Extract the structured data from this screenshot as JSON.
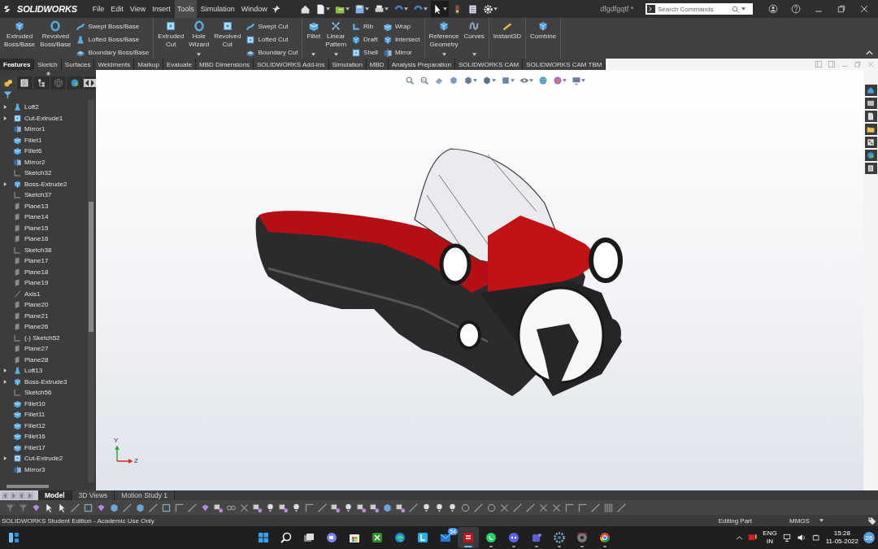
{
  "app": {
    "logo": "SOLIDWORKS",
    "document_title": "dfgdfgqtf *"
  },
  "menu": [
    {
      "label": "File",
      "selected": false
    },
    {
      "label": "Edit",
      "selected": false
    },
    {
      "label": "View",
      "selected": false
    },
    {
      "label": "Insert",
      "selected": false
    },
    {
      "label": "Tools",
      "selected": true
    },
    {
      "label": "Simulation",
      "selected": false
    },
    {
      "label": "Window",
      "selected": false
    }
  ],
  "search": {
    "placeholder": "Search Commands"
  },
  "ribbon": [
    {
      "items": [
        {
          "kind": "large",
          "label": "Extruded Boss/Base",
          "dropdown": false
        },
        {
          "kind": "large",
          "label": "Revolved Boss/Base",
          "dropdown": false
        },
        {
          "kind": "stack",
          "labels": [
            "Swept Boss/Base",
            "Lofted Boss/Base",
            "Boundary Boss/Base"
          ]
        }
      ]
    },
    {
      "items": [
        {
          "kind": "large",
          "label": "Extruded Cut",
          "dropdown": false
        },
        {
          "kind": "large",
          "label": "Hole Wizard",
          "dropdown": true
        },
        {
          "kind": "large",
          "label": "Revolved Cut",
          "dropdown": false
        },
        {
          "kind": "stack",
          "labels": [
            "Swept Cut",
            "Lofted Cut",
            "Boundary Cut"
          ]
        }
      ]
    },
    {
      "items": [
        {
          "kind": "large",
          "label": "Fillet",
          "dropdown": true
        },
        {
          "kind": "large",
          "label": "Linear Pattern",
          "dropdown": true
        },
        {
          "kind": "stack",
          "labels": [
            "Rib",
            "Draft",
            "Shell"
          ]
        },
        {
          "kind": "stack",
          "labels": [
            "Wrap",
            "Intersect",
            "Mirror"
          ]
        }
      ]
    },
    {
      "items": [
        {
          "kind": "large",
          "label": "Reference Geometry",
          "dropdown": true
        },
        {
          "kind": "large",
          "label": "Curves",
          "dropdown": true
        }
      ]
    },
    {
      "items": [
        {
          "kind": "large",
          "label": "Instant3D",
          "dropdown": false
        }
      ]
    },
    {
      "items": [
        {
          "kind": "large",
          "label": "Combine",
          "dropdown": false
        }
      ]
    }
  ],
  "feature_tabs": [
    {
      "label": "Features",
      "selected": true
    },
    {
      "label": "Sketch",
      "selected": false
    },
    {
      "label": "Surfaces",
      "selected": false
    },
    {
      "label": "Weldments",
      "selected": false
    },
    {
      "label": "Markup",
      "selected": false
    },
    {
      "label": "Evaluate",
      "selected": false
    },
    {
      "label": "MBD Dimensions",
      "selected": false
    },
    {
      "label": "SOLIDWORKS Add-Ins",
      "selected": false
    },
    {
      "label": "Simulation",
      "selected": false
    },
    {
      "label": "MBD",
      "selected": false
    },
    {
      "label": "Analysis Preparation",
      "selected": false
    },
    {
      "label": "SOLIDWORKS CAM",
      "selected": false
    },
    {
      "label": "SOLIDWORKS CAM TBM",
      "selected": false
    }
  ],
  "tree": [
    {
      "label": "Loft2",
      "kind": "loft",
      "expanded": false
    },
    {
      "label": "Cut-Extrude1",
      "kind": "cut",
      "expanded": false
    },
    {
      "label": "Mirror1",
      "kind": "mirror"
    },
    {
      "label": "Fillet1",
      "kind": "fillet"
    },
    {
      "label": "Fillet6",
      "kind": "fillet"
    },
    {
      "label": "Mirror2",
      "kind": "mirror"
    },
    {
      "label": "Sketch32",
      "kind": "sketch"
    },
    {
      "label": "Boss-Extrude2",
      "kind": "boss",
      "expanded": false
    },
    {
      "label": "Sketch37",
      "kind": "sketch"
    },
    {
      "label": "Plane13",
      "kind": "plane"
    },
    {
      "label": "Plane14",
      "kind": "plane"
    },
    {
      "label": "Plane15",
      "kind": "plane"
    },
    {
      "label": "Plane16",
      "kind": "plane"
    },
    {
      "label": "Sketch38",
      "kind": "sketch"
    },
    {
      "label": "Plane17",
      "kind": "plane"
    },
    {
      "label": "Plane18",
      "kind": "plane"
    },
    {
      "label": "Plane19",
      "kind": "plane"
    },
    {
      "label": "Axis1",
      "kind": "axis"
    },
    {
      "label": "Plane20",
      "kind": "plane"
    },
    {
      "label": "Plane21",
      "kind": "plane"
    },
    {
      "label": "Plane26",
      "kind": "plane"
    },
    {
      "label": "(-) Sketch52",
      "kind": "sketch"
    },
    {
      "label": "Plane27",
      "kind": "plane"
    },
    {
      "label": "Plane28",
      "kind": "plane"
    },
    {
      "label": "Loft13",
      "kind": "loft",
      "expanded": false
    },
    {
      "label": "Boss-Extrude3",
      "kind": "boss",
      "expanded": false
    },
    {
      "label": "Sketch56",
      "kind": "sketch"
    },
    {
      "label": "Fillet10",
      "kind": "fillet"
    },
    {
      "label": "Fillet11",
      "kind": "fillet"
    },
    {
      "label": "Fillet12",
      "kind": "fillet"
    },
    {
      "label": "Fillet16",
      "kind": "fillet"
    },
    {
      "label": "Fillet17",
      "kind": "fillet"
    },
    {
      "label": "Cut-Extrude2",
      "kind": "cut",
      "expanded": false
    },
    {
      "label": "Mirror3",
      "kind": "mirror"
    }
  ],
  "triad": {
    "up": "Y",
    "right": "Z"
  },
  "panel_tabs": [
    {
      "selected": true
    },
    {
      "selected": false
    },
    {
      "selected": false
    },
    {
      "selected": false
    },
    {
      "selected": false
    }
  ],
  "view_tabs": [
    {
      "label": "Model",
      "selected": true
    },
    {
      "label": "3D Views",
      "selected": false
    },
    {
      "label": "Motion Study 1",
      "selected": false
    }
  ],
  "status_bar": {
    "edition": "SOLIDWORKS Student Edition - Academic Use Only",
    "mode": "Editing Part",
    "units": "MMGS"
  },
  "taskbar": {
    "widgets": {
      "kind": "widgets"
    },
    "apps": [
      {
        "kind": "start",
        "running": false,
        "selected": false
      },
      {
        "kind": "search",
        "running": false,
        "selected": false
      },
      {
        "kind": "taskview",
        "running": false,
        "selected": false
      },
      {
        "kind": "chat",
        "running": false,
        "selected": false
      },
      {
        "kind": "store",
        "running": false,
        "selected": false
      },
      {
        "kind": "xbox",
        "running": false,
        "selected": false
      },
      {
        "kind": "edge",
        "running": false,
        "selected": false
      },
      {
        "kind": "launcher",
        "running": false,
        "selected": false
      },
      {
        "kind": "mail",
        "running": false,
        "selected": false,
        "badge": "54"
      },
      {
        "kind": "solidworks",
        "running": true,
        "selected": true
      },
      {
        "kind": "whatsapp",
        "running": true,
        "selected": false
      },
      {
        "kind": "discord",
        "running": true,
        "selected": false
      },
      {
        "kind": "teams",
        "running": true,
        "selected": false
      },
      {
        "kind": "settings",
        "running": true,
        "selected": false
      },
      {
        "kind": "disc",
        "running": true,
        "selected": false
      },
      {
        "kind": "chrome",
        "running": true,
        "selected": false
      }
    ],
    "language": "ENG",
    "region": "IN",
    "time": "15:28",
    "date": "11-05-2022",
    "notifications": "26"
  }
}
